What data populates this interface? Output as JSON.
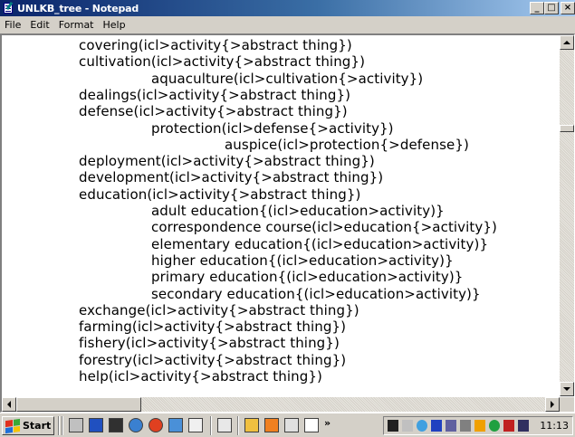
{
  "window": {
    "title": "UNLKB_tree - Notepad",
    "minimize": "_",
    "maximize": "□",
    "close": "×"
  },
  "menu": [
    "File",
    "Edit",
    "Format",
    "Help"
  ],
  "document": {
    "lines": [
      {
        "indent": 0,
        "text": "covering(icl>activity{>abstract thing})"
      },
      {
        "indent": 0,
        "text": "cultivation(icl>activity{>abstract thing})"
      },
      {
        "indent": 1,
        "text": "aquaculture(icl>cultivation{>activity})"
      },
      {
        "indent": 0,
        "text": "dealings(icl>activity{>abstract thing})"
      },
      {
        "indent": 0,
        "text": "defense(icl>activity{>abstract thing})"
      },
      {
        "indent": 1,
        "text": "protection(icl>defense{>activity})"
      },
      {
        "indent": 2,
        "text": "auspice(icl>protection{>defense})"
      },
      {
        "indent": 0,
        "text": "deployment(icl>activity{>abstract thing})"
      },
      {
        "indent": 0,
        "text": "development(icl>activity{>abstract thing})"
      },
      {
        "indent": 0,
        "text": "education(icl>activity{>abstract thing})"
      },
      {
        "indent": 1,
        "text": "adult education{(icl>education>activity)}"
      },
      {
        "indent": 1,
        "text": "correspondence course(icl>education{>activity})"
      },
      {
        "indent": 1,
        "text": "elementary education{(icl>education>activity)}"
      },
      {
        "indent": 1,
        "text": "higher education{(icl>education>activity)}"
      },
      {
        "indent": 1,
        "text": "primary education{(icl>education>activity)}"
      },
      {
        "indent": 1,
        "text": "secondary education{(icl>education>activity)}"
      },
      {
        "indent": 0,
        "text": "exchange(icl>activity{>abstract thing})"
      },
      {
        "indent": 0,
        "text": "farming(icl>activity{>abstract thing})"
      },
      {
        "indent": 0,
        "text": "fishery(icl>activity{>abstract thing})"
      },
      {
        "indent": 0,
        "text": "forestry(icl>activity{>abstract thing})"
      },
      {
        "indent": 0,
        "text": "help(icl>activity{>abstract thing})"
      }
    ]
  },
  "taskbar": {
    "start_label": "Start",
    "more_label": "»",
    "clock": "11:13"
  },
  "colors": {
    "title_start": "#0a246a",
    "title_end": "#a6caf0",
    "face": "#d4d0c8"
  }
}
